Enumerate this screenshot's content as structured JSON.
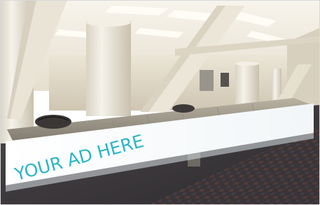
{
  "image": {
    "kind": "photo",
    "subject": "airport-baggage-claim-hall",
    "ad_banner": {
      "text": "YOUR AD HERE",
      "text_color": "#2bb5c8",
      "banner_color": "#ffffff"
    },
    "palette": {
      "ceiling": "#f1ede2",
      "wall": "#e7e1d2",
      "column": "#eeeade",
      "floor_dark": "#3d3a3e",
      "carpet_accent": "#7a4a3c",
      "belt": "#9b9589"
    }
  }
}
